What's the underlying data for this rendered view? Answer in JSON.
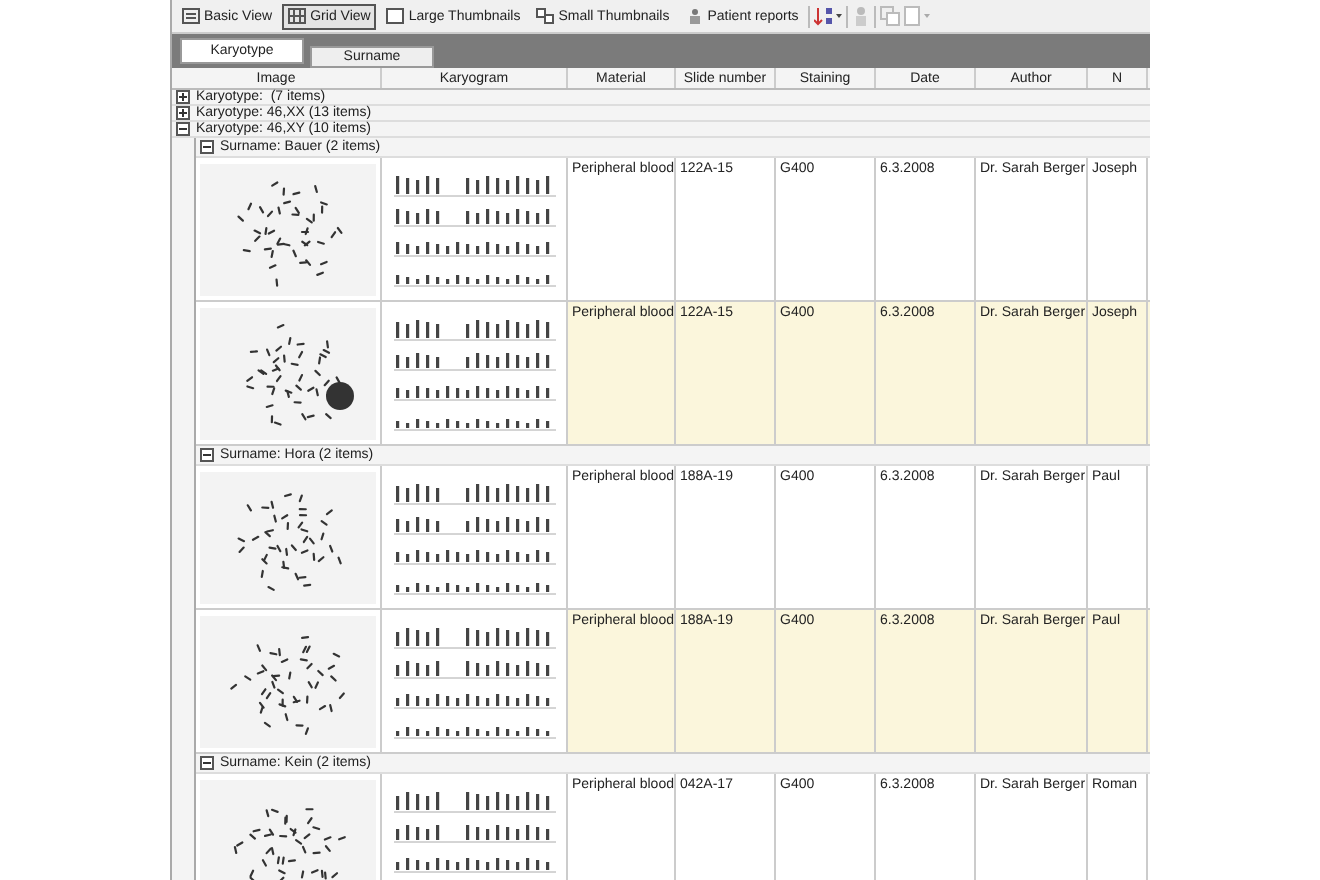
{
  "toolbar": {
    "buttons": [
      {
        "kind": "list",
        "label": "Basic View",
        "selected": false
      },
      {
        "kind": "grid",
        "label": "Grid View",
        "selected": true
      },
      {
        "kind": "large",
        "label": "Large Thumbnails",
        "selected": false
      },
      {
        "kind": "small",
        "label": "Small Thumbnails",
        "selected": false
      },
      {
        "kind": "report",
        "label": "Patient reports",
        "selected": false
      }
    ]
  },
  "tabs": [
    {
      "label": "Karyotype",
      "selected": true
    },
    {
      "label": "Surname",
      "selected": false
    }
  ],
  "table": {
    "columns": [
      "Image",
      "Karyogram",
      "Material",
      "Slide number",
      "Staining",
      "Date",
      "Author",
      "N"
    ],
    "groups": [
      {
        "label": "Karyotype:  (7 items)",
        "expanded": false
      },
      {
        "label": "Karyotype: 46,XX (13 items)",
        "expanded": false
      },
      {
        "label": "Karyotype: 46,XY (10 items)",
        "expanded": true,
        "children": [
          {
            "label": "Surname: Bauer (2 items)",
            "expanded": true,
            "rows": [
              {
                "shaded": false,
                "cells": [
                  "Peripheral blood",
                  "122A-15",
                  "G400",
                  "6.3.2008",
                  "Dr. Sarah Berger",
                  "Joseph"
                ]
              },
              {
                "shaded": true,
                "cells": [
                  "Peripheral blood",
                  "122A-15",
                  "G400",
                  "6.3.2008",
                  "Dr. Sarah Berger",
                  "Joseph"
                ]
              }
            ]
          },
          {
            "label": "Surname: Hora (2 items)",
            "expanded": true,
            "rows": [
              {
                "shaded": false,
                "cells": [
                  "Peripheral blood",
                  "188A-19",
                  "G400",
                  "6.3.2008",
                  "Dr. Sarah Berger",
                  "Paul"
                ]
              },
              {
                "shaded": true,
                "cells": [
                  "Peripheral blood",
                  "188A-19",
                  "G400",
                  "6.3.2008",
                  "Dr. Sarah Berger",
                  "Paul"
                ]
              }
            ]
          },
          {
            "label": "Surname: Kein (2 items)",
            "expanded": true,
            "rows": [
              {
                "shaded": false,
                "cells": [
                  "Peripheral blood",
                  "042A-17",
                  "G400",
                  "6.3.2008",
                  "Dr. Sarah Berger",
                  "Roman"
                ]
              }
            ]
          }
        ]
      }
    ]
  }
}
